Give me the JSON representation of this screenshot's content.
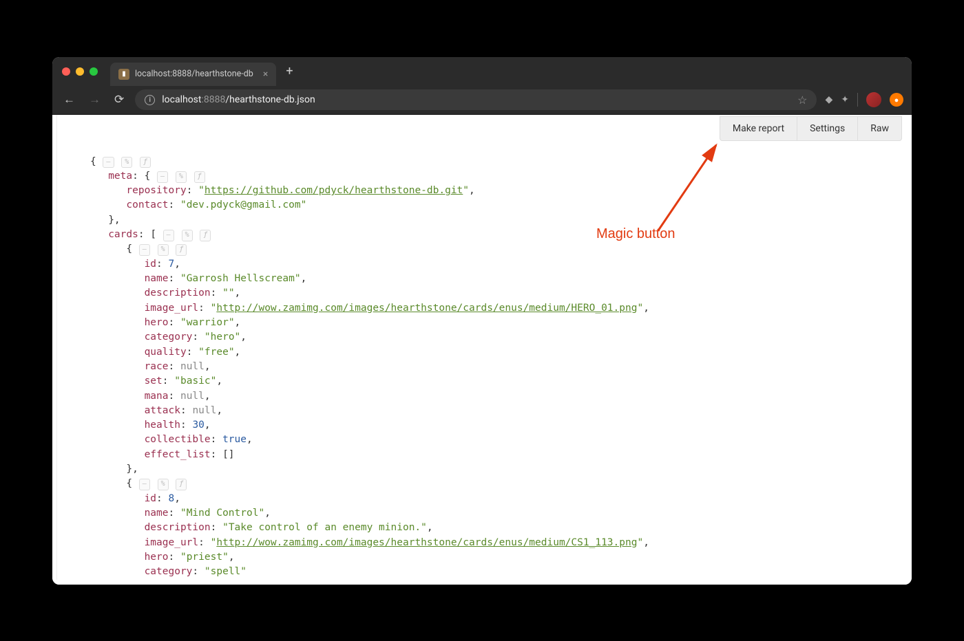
{
  "browser": {
    "tab_title": "localhost:8888/hearthstone-db",
    "url_host": "localhost",
    "url_port": ":8888",
    "url_path": "/hearthstone-db.json"
  },
  "toolbar": {
    "make_report": "Make report",
    "settings": "Settings",
    "raw": "Raw"
  },
  "annotation": {
    "label": "Magic button"
  },
  "ctl": {
    "minus": "–",
    "pct": "%",
    "f": "ƒ"
  },
  "json": {
    "meta_key": "meta",
    "repository_key": "repository",
    "repository_val": "https://github.com/pdyck/hearthstone-db.git",
    "contact_key": "contact",
    "contact_val": "dev.pdyck@gmail.com",
    "cards_key": "cards",
    "c1": {
      "id_key": "id",
      "id_val": "7",
      "name_key": "name",
      "name_val": "Garrosh Hellscream",
      "description_key": "description",
      "description_val": "",
      "image_url_key": "image_url",
      "image_url_val": "http://wow.zamimg.com/images/hearthstone/cards/enus/medium/HERO_01.png",
      "hero_key": "hero",
      "hero_val": "warrior",
      "category_key": "category",
      "category_val": "hero",
      "quality_key": "quality",
      "quality_val": "free",
      "race_key": "race",
      "race_val": "null",
      "set_key": "set",
      "set_val": "basic",
      "mana_key": "mana",
      "mana_val": "null",
      "attack_key": "attack",
      "attack_val": "null",
      "health_key": "health",
      "health_val": "30",
      "collectible_key": "collectible",
      "collectible_val": "true",
      "effect_list_key": "effect_list"
    },
    "c2": {
      "id_key": "id",
      "id_val": "8",
      "name_key": "name",
      "name_val": "Mind Control",
      "description_key": "description",
      "description_val": "Take control of an enemy minion.",
      "image_url_key": "image_url",
      "image_url_val": "http://wow.zamimg.com/images/hearthstone/cards/enus/medium/CS1_113.png",
      "hero_key": "hero",
      "hero_val": "priest",
      "category_key": "category",
      "category_val": "spell"
    }
  }
}
